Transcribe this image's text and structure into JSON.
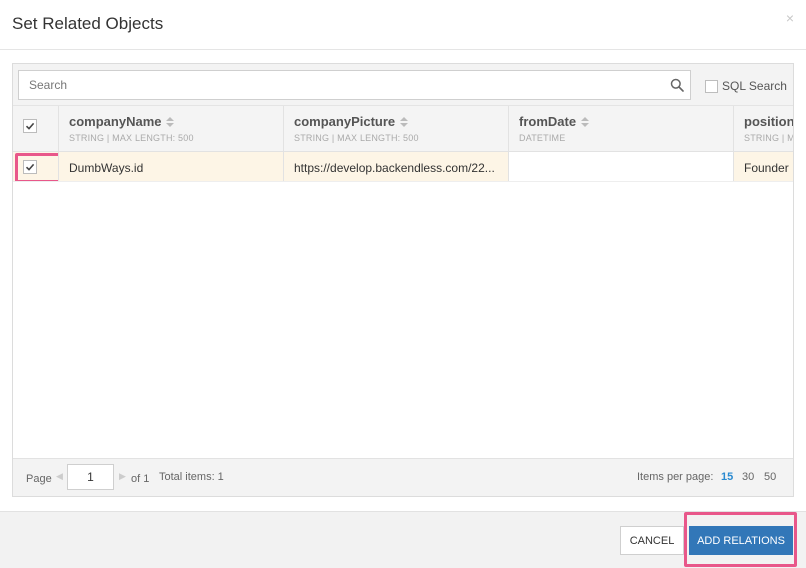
{
  "dialog": {
    "title": "Set Related Objects",
    "close_glyph": "×"
  },
  "search": {
    "placeholder": "Search",
    "value": "",
    "sql_label": "SQL Search",
    "sql_checked": false
  },
  "columns": [
    {
      "name": "companyName",
      "type": "STRING | MAX LENGTH: 500"
    },
    {
      "name": "companyPicture",
      "type": "STRING | MAX LENGTH: 500"
    },
    {
      "name": "fromDate",
      "type": "DATETIME"
    },
    {
      "name": "position",
      "type": "STRING | MAX"
    }
  ],
  "rows": [
    {
      "checked": true,
      "companyName": "DumbWays.id",
      "companyPicture": "https://develop.backendless.com/22...",
      "fromDate": "",
      "position": "Founder"
    }
  ],
  "pagination": {
    "page_label": "Page",
    "page_value": "1",
    "of_label": "of 1",
    "total_label": "Total items: 1",
    "per_page_label": "Items per page:",
    "options": [
      "15",
      "30",
      "50"
    ],
    "selected": "15"
  },
  "footer": {
    "cancel_label": "CANCEL",
    "add_label": "ADD RELATIONS"
  },
  "colors": {
    "accent": "#3277b8",
    "highlight": "#e8578a",
    "row_selected": "#fdf5e6",
    "link": "#2a8ad0"
  }
}
